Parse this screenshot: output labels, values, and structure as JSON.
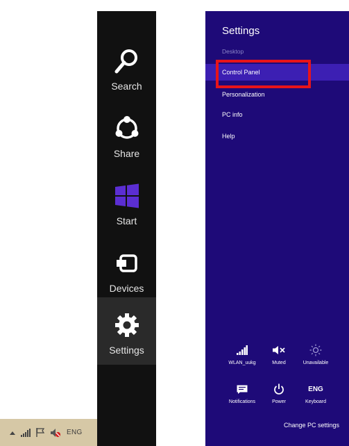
{
  "taskbar": {
    "icons": [
      "up-arrow-icon",
      "signal-icon",
      "flag-icon",
      "speaker-muted-icon"
    ],
    "language": "ENG"
  },
  "charms": {
    "items": [
      {
        "label": "Search",
        "icon": "search-icon"
      },
      {
        "label": "Share",
        "icon": "share-icon"
      },
      {
        "label": "Start",
        "icon": "windows-logo-icon"
      },
      {
        "label": "Devices",
        "icon": "devices-icon"
      },
      {
        "label": "Settings",
        "icon": "gear-icon"
      }
    ],
    "start_color": "#5b2ed3"
  },
  "settings_pane": {
    "title": "Settings",
    "subtitle": "Desktop",
    "menu": [
      {
        "label": "Control Panel"
      },
      {
        "label": "Personalization"
      },
      {
        "label": "PC info"
      },
      {
        "label": "Help"
      }
    ],
    "tiles": [
      {
        "label": "WLAN_uukg",
        "icon": "signal-icon"
      },
      {
        "label": "Muted",
        "icon": "speaker-muted-icon"
      },
      {
        "label": "Unavailable",
        "icon": "brightness-icon"
      },
      {
        "label": "Notifications",
        "icon": "notifications-icon"
      },
      {
        "label": "Power",
        "icon": "power-icon",
        "glyph": ""
      },
      {
        "label": "Keyboard",
        "icon": "keyboard-icon",
        "glyph": "ENG"
      }
    ],
    "change_pc_settings": "Change PC settings",
    "background_color": "#1e0a78",
    "highlight_color": "#e8141a"
  }
}
